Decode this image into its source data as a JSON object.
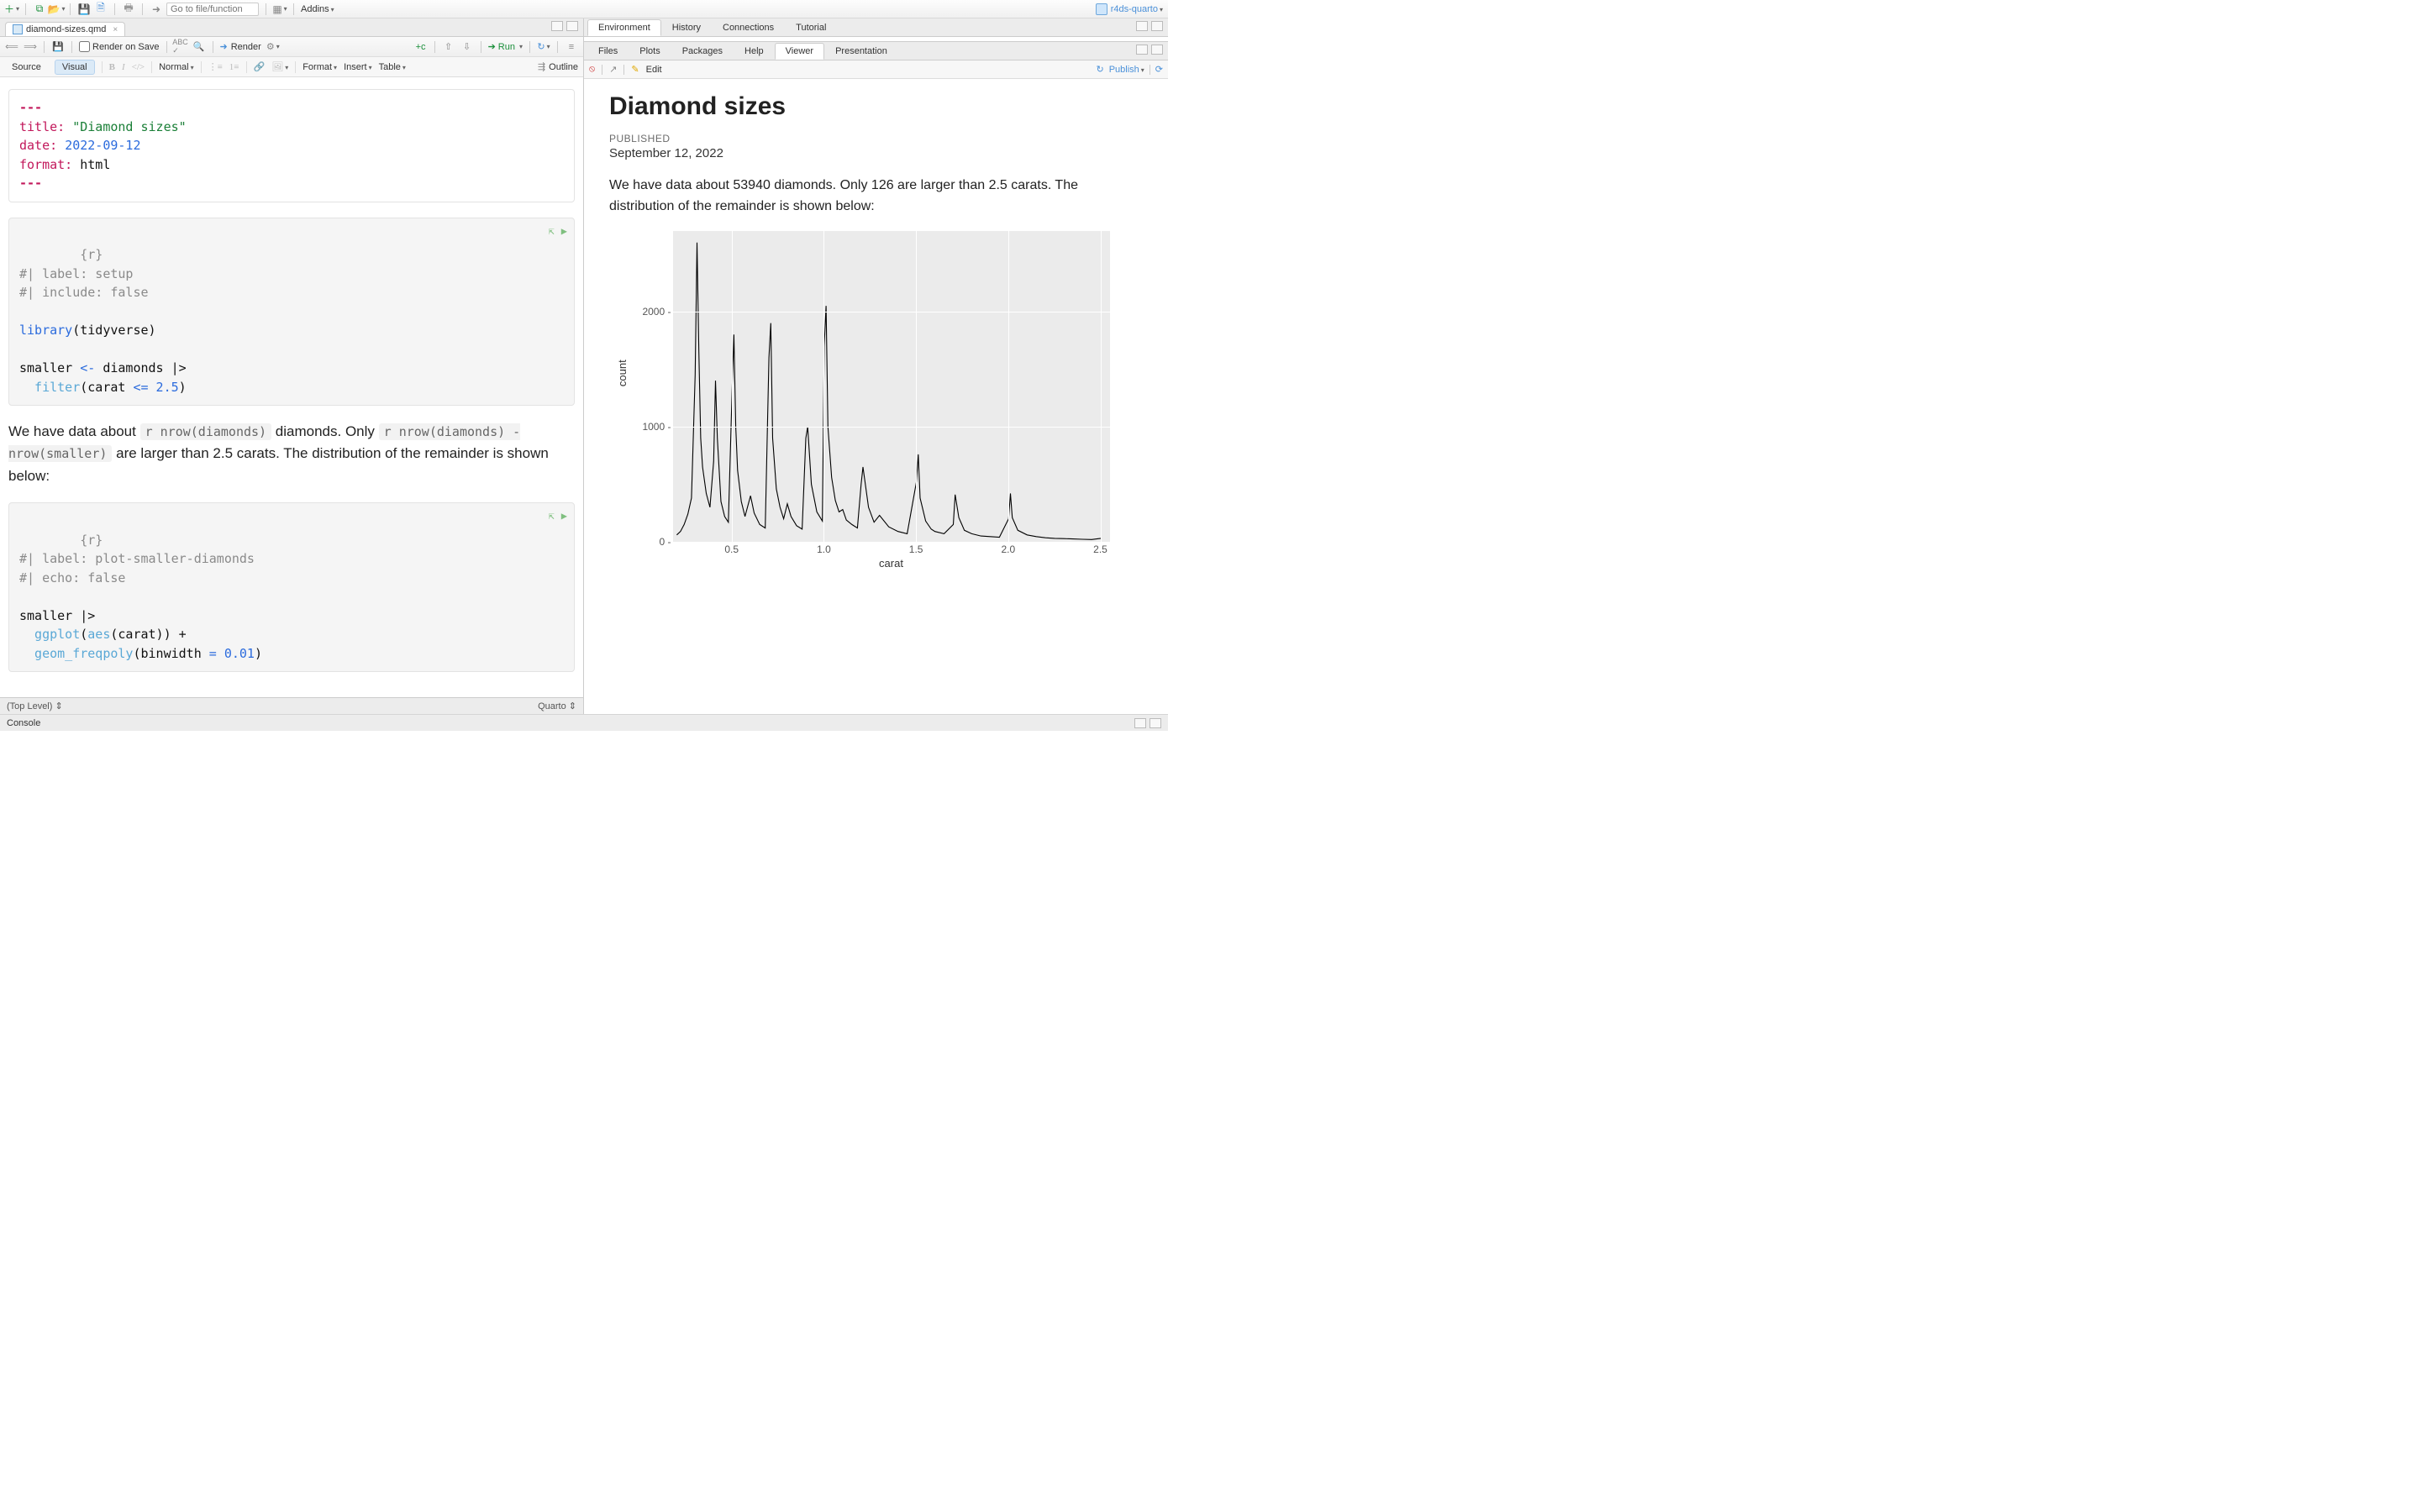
{
  "project_name": "r4ds-quarto",
  "goto_placeholder": "Go to file/function",
  "addins_label": "Addins",
  "file_tab": {
    "name": "diamond-sizes.qmd"
  },
  "editor_tb1": {
    "render_on_save": "Render on Save",
    "render": "Render",
    "run": "Run"
  },
  "editor_tb2": {
    "source": "Source",
    "visual": "Visual",
    "normal": "Normal",
    "format": "Format",
    "insert": "Insert",
    "table": "Table",
    "outline": "Outline"
  },
  "yaml": {
    "dashes": "---",
    "title_key": "title:",
    "title_val": "\"Diamond sizes\"",
    "date_key": "date:",
    "date_val": "2022-09-12",
    "format_key": "format:",
    "format_val": "html"
  },
  "chunk1": {
    "header": "{r}",
    "c1": "#| label: setup",
    "c2": "#| include: false",
    "lib": "library",
    "lib_arg": "(tidyverse)",
    "line1a": "smaller ",
    "assign": "<-",
    "line1b": " diamonds |>",
    "filt": "  filter",
    "filt_arg_open": "(carat ",
    "lte": "<=",
    "filt_num": " 2.5",
    "filt_close": ")"
  },
  "prose": {
    "p1": "We have data about ",
    "c1": "r nrow(diamonds)",
    "p2": " diamonds. Only ",
    "c2": "r nrow(diamonds) - nrow(smaller)",
    "p3": " are larger than 2.5 carats. The distribution of the remainder is shown below:"
  },
  "chunk2": {
    "header": "{r}",
    "c1": "#| label: plot-smaller-diamonds",
    "c2": "#| echo: false",
    "l1": "smaller |>",
    "gg": "  ggplot",
    "gg_open": "(",
    "aes": "aes",
    "aes_arg": "(carat)) +",
    "geom": "  geom_freqpoly",
    "geom_open": "(binwidth ",
    "eq": "=",
    "bw": " 0.01",
    "geom_close": ")"
  },
  "statusbar": {
    "left": "(Top Level)",
    "right": "Quarto"
  },
  "console": "Console",
  "right_tabs_top": [
    "Environment",
    "History",
    "Connections",
    "Tutorial"
  ],
  "right_tabs_bottom": [
    "Files",
    "Plots",
    "Packages",
    "Help",
    "Viewer",
    "Presentation"
  ],
  "viewer_tb": {
    "edit": "Edit",
    "publish": "Publish"
  },
  "rendered": {
    "title": "Diamond sizes",
    "pub_label": "PUBLISHED",
    "pub_date": "September 12, 2022",
    "para": "We have data about 53940 diamonds. Only 126 are larger than 2.5 carats. The distribution of the remainder is shown below:"
  },
  "chart_data": {
    "type": "line",
    "xlabel": "carat",
    "ylabel": "count",
    "xlim": [
      0.18,
      2.55
    ],
    "ylim": [
      0,
      2700
    ],
    "xticks": [
      0.5,
      1.0,
      1.5,
      2.0,
      2.5
    ],
    "yticks": [
      0,
      1000,
      2000
    ],
    "series": [
      {
        "name": "count",
        "x": [
          0.2,
          0.22,
          0.24,
          0.26,
          0.28,
          0.3,
          0.31,
          0.32,
          0.33,
          0.34,
          0.36,
          0.38,
          0.4,
          0.41,
          0.42,
          0.44,
          0.46,
          0.48,
          0.5,
          0.51,
          0.52,
          0.53,
          0.55,
          0.57,
          0.6,
          0.62,
          0.65,
          0.68,
          0.7,
          0.71,
          0.72,
          0.74,
          0.76,
          0.78,
          0.8,
          0.82,
          0.85,
          0.88,
          0.9,
          0.91,
          0.93,
          0.96,
          0.99,
          1.0,
          1.01,
          1.02,
          1.04,
          1.06,
          1.08,
          1.1,
          1.12,
          1.15,
          1.18,
          1.2,
          1.21,
          1.24,
          1.27,
          1.3,
          1.35,
          1.4,
          1.45,
          1.5,
          1.51,
          1.52,
          1.55,
          1.58,
          1.6,
          1.65,
          1.7,
          1.71,
          1.73,
          1.76,
          1.8,
          1.85,
          1.9,
          1.95,
          2.0,
          2.01,
          2.02,
          2.05,
          2.1,
          2.15,
          2.2,
          2.25,
          2.3,
          2.35,
          2.4,
          2.45,
          2.5
        ],
        "y": [
          60,
          90,
          150,
          240,
          380,
          1450,
          2600,
          1650,
          900,
          650,
          420,
          300,
          700,
          1400,
          900,
          350,
          220,
          170,
          1300,
          1800,
          1000,
          620,
          350,
          220,
          400,
          250,
          150,
          120,
          1600,
          1900,
          900,
          460,
          300,
          200,
          330,
          220,
          140,
          110,
          900,
          1000,
          500,
          260,
          180,
          1700,
          2050,
          1000,
          560,
          360,
          260,
          280,
          190,
          150,
          120,
          500,
          650,
          300,
          170,
          230,
          130,
          90,
          70,
          520,
          760,
          380,
          180,
          110,
          90,
          70,
          150,
          410,
          210,
          100,
          70,
          50,
          45,
          40,
          200,
          420,
          210,
          100,
          60,
          45,
          35,
          30,
          28,
          25,
          22,
          20,
          30
        ]
      }
    ]
  }
}
